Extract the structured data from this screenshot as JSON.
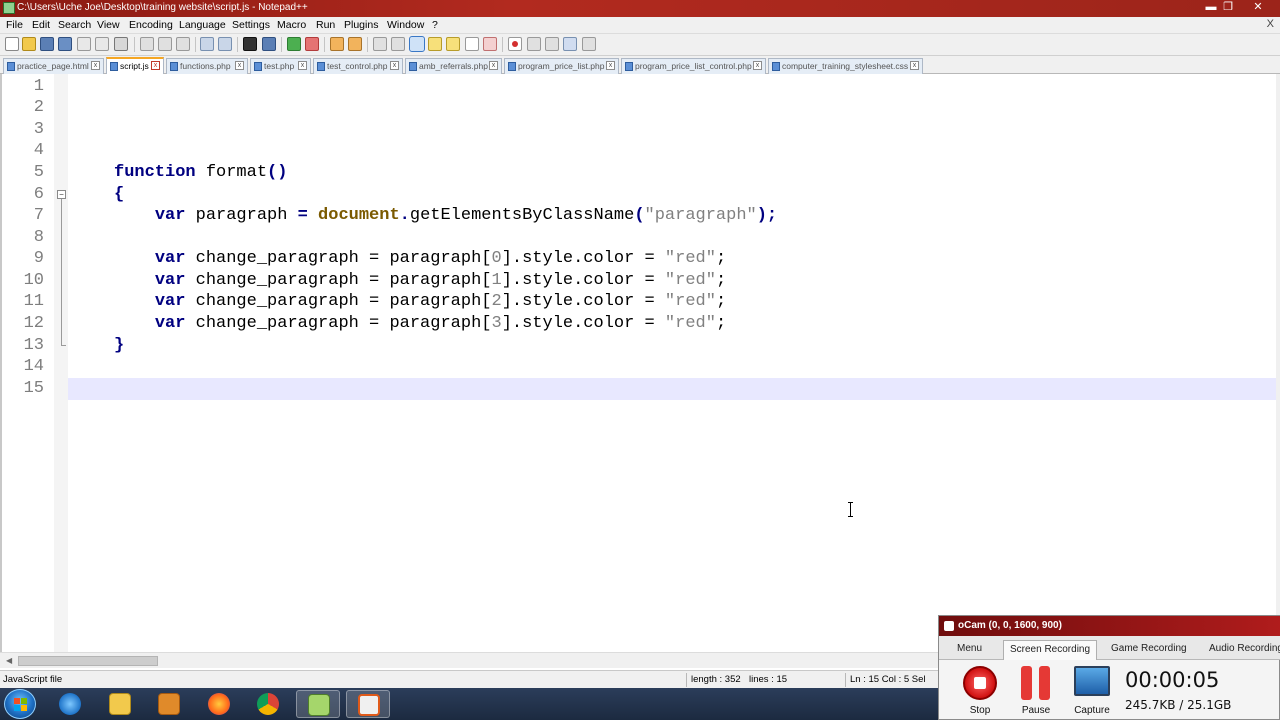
{
  "window": {
    "title": "C:\\Users\\Uche Joe\\Desktop\\training website\\script.js - Notepad++",
    "minimize": "▬",
    "restore": "❐",
    "close": "✕"
  },
  "menu": {
    "items": [
      "File",
      "Edit",
      "Search",
      "View",
      "Encoding",
      "Language",
      "Settings",
      "Macro",
      "Run",
      "Plugins",
      "Window",
      "?"
    ],
    "close": "X"
  },
  "tabs": [
    {
      "label": "practice_page.html",
      "active": false
    },
    {
      "label": "script.js",
      "active": true
    },
    {
      "label": "functions.php",
      "active": false
    },
    {
      "label": "test.php",
      "active": false
    },
    {
      "label": "test_control.php",
      "active": false
    },
    {
      "label": "amb_referrals.php",
      "active": false
    },
    {
      "label": "program_price_list.php",
      "active": false
    },
    {
      "label": "program_price_list_control.php",
      "active": false
    },
    {
      "label": "computer_training_stylesheet.css",
      "active": false
    }
  ],
  "editor": {
    "line_numbers": [
      "1",
      "2",
      "3",
      "4",
      "5",
      "6",
      "7",
      "8",
      "9",
      "10",
      "11",
      "12",
      "13",
      "14",
      "15"
    ],
    "current_line": 15,
    "fold_marker": "−"
  },
  "status": {
    "file_type": "JavaScript file",
    "length": "length : 352",
    "lines": "lines : 15",
    "position": "Ln : 15    Col : 5    Sel"
  },
  "taskbar": {
    "apps": [
      "ie-icon",
      "folder-icon",
      "media-player-icon",
      "firefox-icon",
      "chrome-icon",
      "notepadpp-icon",
      "ocam-icon"
    ],
    "active_app": "ocam-icon"
  },
  "ocam": {
    "title": "oCam (0, 0, 1600, 900)",
    "tabs": [
      "Menu",
      "Screen Recording",
      "Game Recording",
      "Audio Recording"
    ],
    "active_tab": "Screen Recording",
    "controls": [
      "Stop",
      "Pause",
      "Capture"
    ],
    "timer": "00:00:05",
    "size": "245.7KB / 25.1GB"
  },
  "colors": {
    "keyword": "#000080",
    "object": "#7b5a00",
    "string": "#808080",
    "current_line_bg": "#e8e8ff",
    "title_bar": "#b22a1f"
  }
}
